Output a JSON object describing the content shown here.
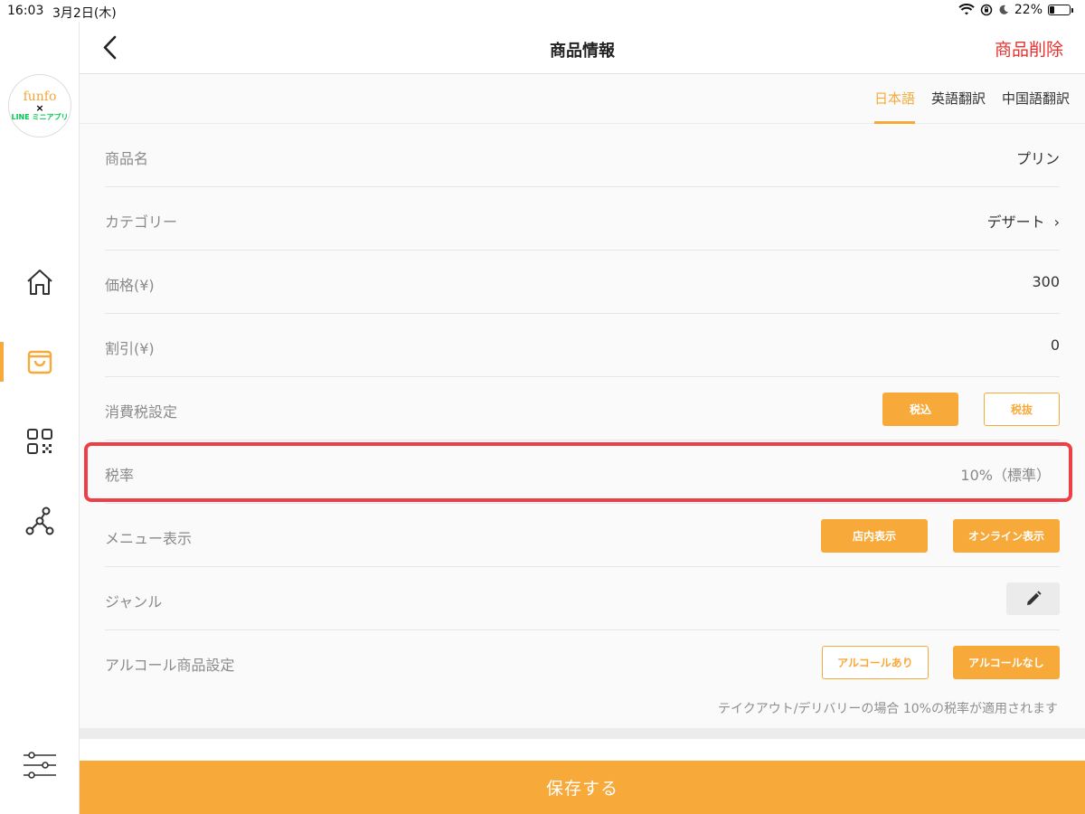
{
  "status_bar": {
    "time": "16:03",
    "date": "3月2日(木)",
    "battery": "22%",
    "battery_level": 0.22
  },
  "logo": {
    "brand": "funfo",
    "cross": "×",
    "partner": "LINE ミニアプリ"
  },
  "sidebar": {
    "items": [
      {
        "icon": "home-icon",
        "active": false
      },
      {
        "icon": "shopping-bag-icon",
        "active": true
      },
      {
        "icon": "qr-code-icon",
        "active": false
      },
      {
        "icon": "share-network-icon",
        "active": false
      },
      {
        "icon": "sliders-icon",
        "active": false
      }
    ]
  },
  "header": {
    "title": "商品情報",
    "delete_label": "商品削除"
  },
  "tabs": [
    {
      "label": "日本語",
      "active": true
    },
    {
      "label": "英語翻訳",
      "active": false
    },
    {
      "label": "中国語翻訳",
      "active": false
    }
  ],
  "form": {
    "product_name": {
      "label": "商品名",
      "value": "プリン"
    },
    "category": {
      "label": "カテゴリー",
      "value": "デザート",
      "chevron": "›"
    },
    "price": {
      "label": "価格(¥)",
      "value": "300"
    },
    "discount": {
      "label": "割引(¥)",
      "value": "0"
    },
    "tax_setting": {
      "label": "消費税設定",
      "included": "税込",
      "excluded": "税抜",
      "selected": "税込"
    },
    "tax_rate": {
      "label": "税率",
      "value": "10%（標準）"
    },
    "menu_display": {
      "label": "メニュー表示",
      "in_store": "店内表示",
      "online": "オンライン表示"
    },
    "genre": {
      "label": "ジャンル"
    },
    "alcohol": {
      "label": "アルコール商品設定",
      "yes": "アルコールあり",
      "no": "アルコールなし",
      "selected": "アルコールなし"
    },
    "note": "テイクアウト/デリバリーの場合 10%の税率が適用されます"
  },
  "save_label": "保存する",
  "colors": {
    "accent": "#f7a93a",
    "danger": "#e8312e",
    "highlight": "#ee3f47"
  }
}
